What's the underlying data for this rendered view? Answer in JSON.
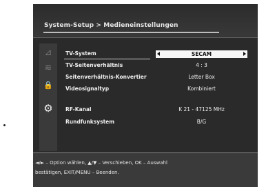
{
  "header": {
    "title": "System-Setup > Medieneinstellungen"
  },
  "sidebar": {
    "icons": [
      {
        "name": "antenna-icon",
        "glyph": "⊿"
      },
      {
        "name": "satellite-dish-icon",
        "glyph": "≋"
      },
      {
        "name": "lock-icon",
        "glyph": "🔒"
      },
      {
        "name": "gear-icon",
        "glyph": "⚙"
      }
    ]
  },
  "settings": [
    {
      "label": "TV-System",
      "value": "SECAM",
      "selected": true
    },
    {
      "label": "TV-Seitenverhältnis",
      "value": "4 : 3"
    },
    {
      "label": "Seitenverhältnis-Konvertier",
      "value": "Letter Box"
    },
    {
      "label": "Videosignaltyp",
      "value": "Kombiniert"
    },
    {
      "label": "RF-Kanal",
      "value": "K 21 - 47125 MHz"
    },
    {
      "label": "Rundfunksystem",
      "value": "B/G"
    }
  ],
  "footer": {
    "line1": "◄/► – Option wählen, ▲/▼ – Verschieben, OK – Auswahl",
    "line2": "bestätigen, EXIT/MENU – Beenden."
  },
  "colors": {
    "background": "#1f1f1f",
    "panel": "#2a2a2a",
    "highlight": "#f7f7f7"
  }
}
